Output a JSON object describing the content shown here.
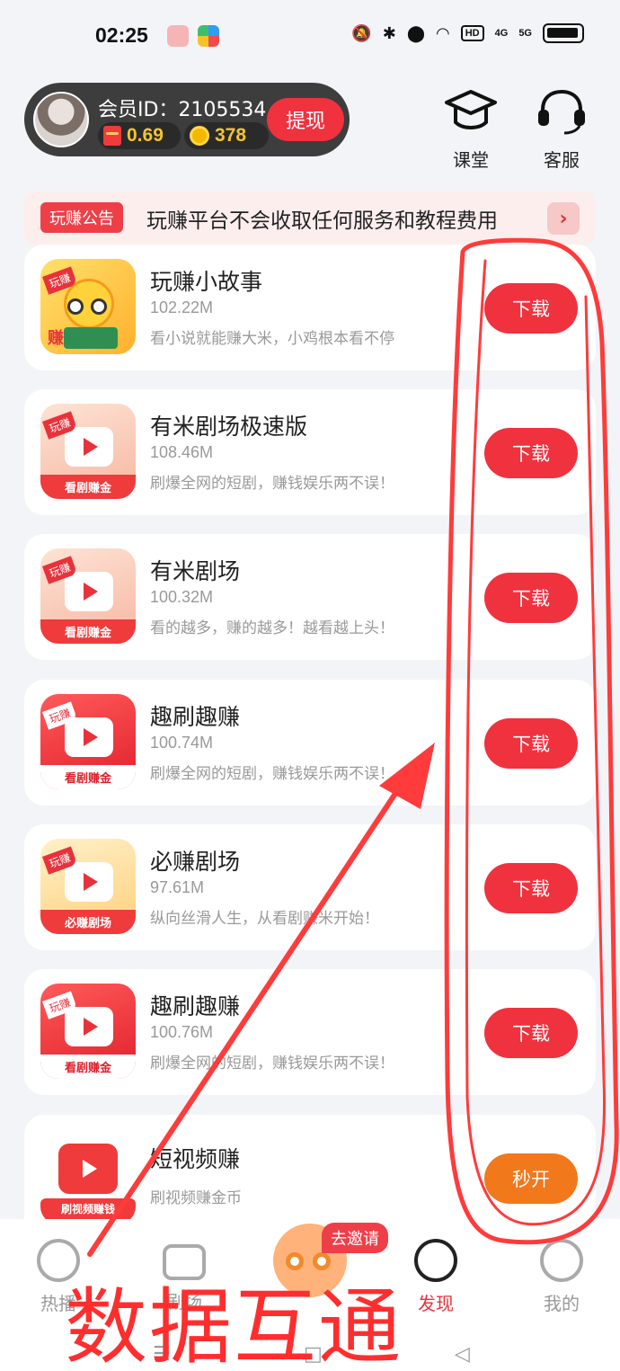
{
  "status_bar": {
    "time": "02:25",
    "hd_label": "HD",
    "signal_1": "4G",
    "signal_2": "5G"
  },
  "member": {
    "id_text": "会员ID：2105534",
    "cash": "0.69",
    "coins": "378",
    "withdraw_label": "提现"
  },
  "top_buttons": {
    "classroom": "课堂",
    "support": "客服"
  },
  "notice": {
    "tag": "玩赚公告",
    "text": "玩赚平台不会收取任何服务和教程费用"
  },
  "apps": [
    {
      "name": "玩赚小故事",
      "size": "102.22M",
      "desc": "看小说就能赚大米，小鸡根本看不停",
      "button": "下载",
      "icon_tag": "玩赚",
      "icon_banner": "赚"
    },
    {
      "name": "有米剧场极速版",
      "size": "108.46M",
      "desc": "刷爆全网的短剧，赚钱娱乐两不误！",
      "button": "下载",
      "icon_tag": "玩赚",
      "icon_banner": "看剧赚金"
    },
    {
      "name": "有米剧场",
      "size": "100.32M",
      "desc": "看的越多，赚的越多！越看越上头！",
      "button": "下载",
      "icon_tag": "玩赚",
      "icon_banner": "看剧赚金"
    },
    {
      "name": "趣刷趣赚",
      "size": "100.74M",
      "desc": "刷爆全网的短剧，赚钱娱乐两不误！",
      "button": "下载",
      "icon_tag": "玩赚",
      "icon_banner": "看剧赚金"
    },
    {
      "name": "必赚剧场",
      "size": "97.61M",
      "desc": "纵向丝滑人生，从看剧赚米开始！",
      "button": "下载",
      "icon_tag": "玩赚",
      "icon_banner": "必赚剧场"
    },
    {
      "name": "趣刷趣赚",
      "size": "100.76M",
      "desc": "刷爆全网的短剧，赚钱娱乐两不误！",
      "button": "下载",
      "icon_tag": "玩赚",
      "icon_banner": "看剧赚金"
    },
    {
      "name": "短视频赚",
      "size": "",
      "desc": "刷视频赚金币",
      "button": "秒开",
      "icon_tag": "",
      "icon_banner": "刷视频赚钱"
    }
  ],
  "bottom_nav": {
    "hot": "热播",
    "theater": "剧场",
    "invite": "去邀请",
    "discover": "发现",
    "mine": "我的"
  },
  "annotation": {
    "caption": "数据互通",
    "color": "#ff2e2e"
  }
}
